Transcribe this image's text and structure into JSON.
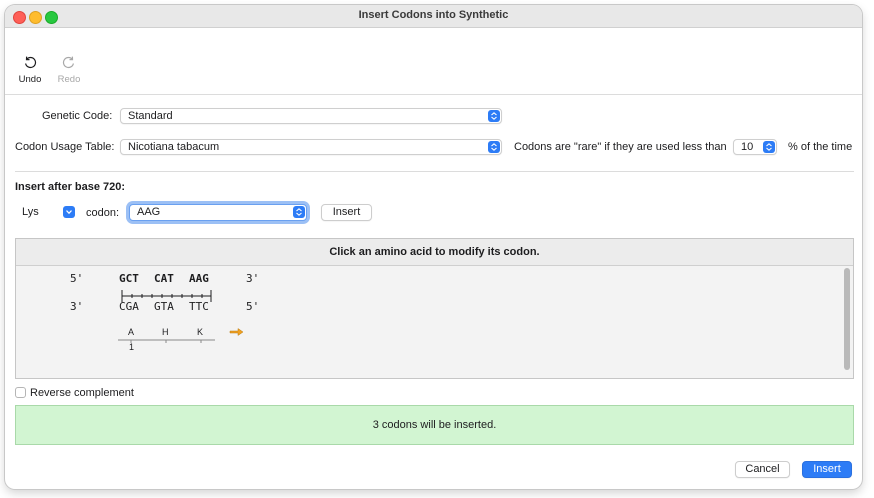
{
  "window": {
    "title": "Insert Codons into Synthetic"
  },
  "toolbar": {
    "undo_label": "Undo",
    "redo_label": "Redo"
  },
  "genetic_code": {
    "label": "Genetic Code:",
    "value": "Standard"
  },
  "codon_usage": {
    "label": "Codon Usage Table:",
    "value": "Nicotiana tabacum",
    "rare_prefix": "Codons are \"rare\" if they are used less than",
    "rare_value": "10",
    "rare_suffix": "% of the time"
  },
  "insert_section": {
    "heading": "Insert after base 720:",
    "amino_acid": "Lys",
    "codon_label": "codon:",
    "codon_value": "AAG",
    "insert_label": "Insert"
  },
  "sequence_panel": {
    "header": "Click an amino acid to modify its codon.",
    "top_left": "5'",
    "top_right": "3'",
    "bottom_left": "3'",
    "bottom_right": "5'",
    "top_codons": [
      "GCT",
      "CAT",
      "AAG"
    ],
    "bottom_codons": [
      "CGA",
      "GTA",
      "TTC"
    ],
    "amino_acids": [
      "A",
      "H",
      "K"
    ],
    "position": "1",
    "arrow_color": "#f0a020"
  },
  "reverse_complement": {
    "label": "Reverse complement",
    "checked": false
  },
  "status": {
    "message": "3 codons will be inserted.",
    "color": "#d2f5d2"
  },
  "footer": {
    "cancel_label": "Cancel",
    "insert_label": "Insert"
  },
  "accent_color": "#2d7cf6"
}
